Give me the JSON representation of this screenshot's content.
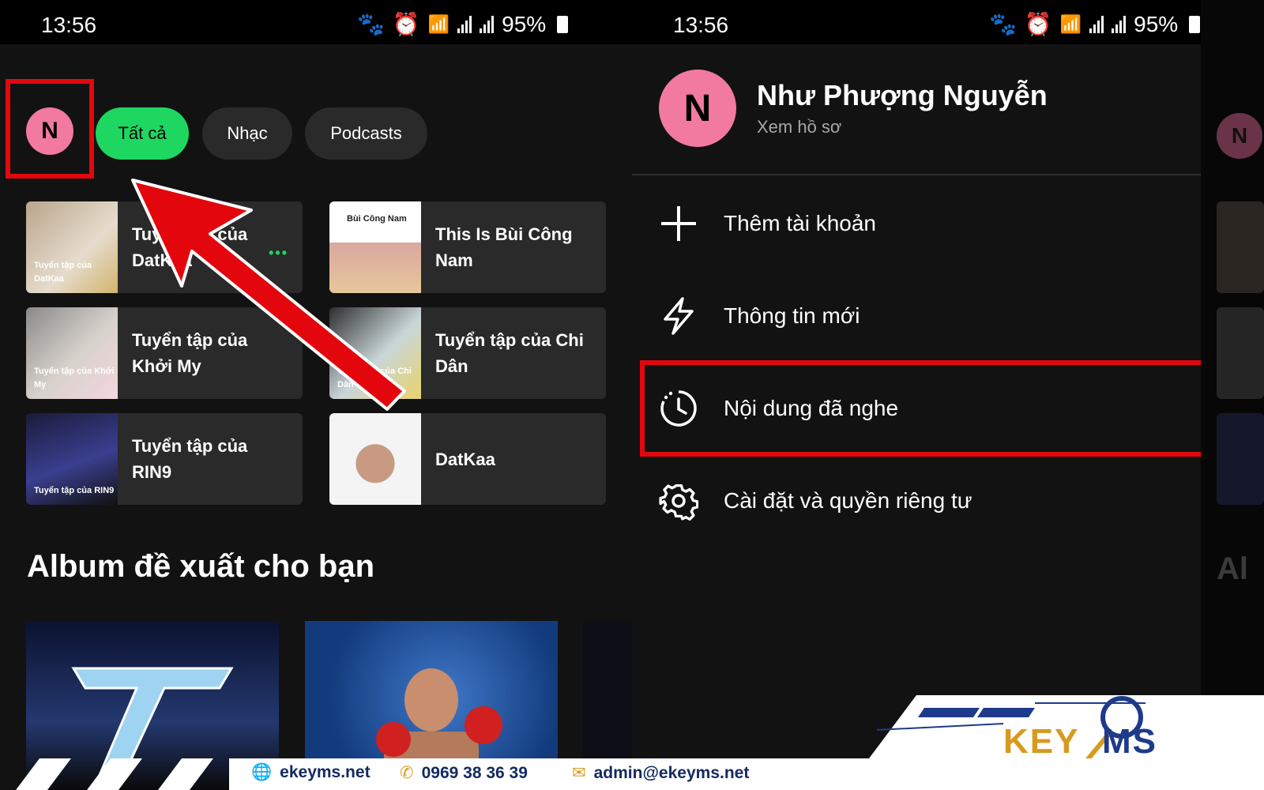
{
  "status_bar": {
    "time": "13:56",
    "battery": "95%",
    "icons": [
      "paw-icon",
      "alarm-icon",
      "wifi-icon",
      "volte-icon",
      "signal-icon",
      "signal-icon",
      "battery-icon"
    ]
  },
  "left": {
    "avatar_letter": "N",
    "chips": [
      {
        "label": "Tất cả",
        "active": true
      },
      {
        "label": "Nhạc",
        "active": false
      },
      {
        "label": "Podcasts",
        "active": false
      }
    ],
    "cards": [
      {
        "title": "Tuyển tập của DatKaa",
        "thumb_label": "Tuyển tập của DatKaa",
        "more": "•••"
      },
      {
        "title": "This Is Bùi Công Nam",
        "thumb_label": "Bùi Công Nam"
      },
      {
        "title": "Tuyển tập của Khởi My",
        "thumb_label": "Tuyển tập của Khởi My"
      },
      {
        "title": "Tuyển tập của Chi Dân",
        "thumb_label": "Tuyển tập của Chi Dân"
      },
      {
        "title": "Tuyển tập của RIN9",
        "thumb_label": "Tuyển tập của RIN9"
      },
      {
        "title": "DatKaa",
        "thumb_label": ""
      }
    ],
    "section_title": "Album đề xuất cho bạn"
  },
  "right": {
    "avatar_letter": "N",
    "profile_name": "Như Phượng Nguyễn",
    "profile_sub": "Xem hồ sơ",
    "menu": [
      {
        "label": "Thêm tài khoản",
        "icon": "plus-icon"
      },
      {
        "label": "Thông tin mới",
        "icon": "lightning-icon"
      },
      {
        "label": "Nội dung đã nghe",
        "icon": "history-icon"
      },
      {
        "label": "Cài đặt và quyền riêng tư",
        "icon": "gear-icon"
      }
    ],
    "edge_letter": "N",
    "edge_heading": "Al"
  },
  "footer": {
    "website": "ekeyms.net",
    "phone": "0969 38 36 39",
    "email": "admin@ekeyms.net",
    "brand_a": "KEY",
    "brand_b": "MS"
  },
  "colors": {
    "accent": "#1ed760",
    "highlight": "#e3070d",
    "avatar": "#f27aa0",
    "brand_blue": "#142a60",
    "brand_gold": "#d89a1e"
  }
}
